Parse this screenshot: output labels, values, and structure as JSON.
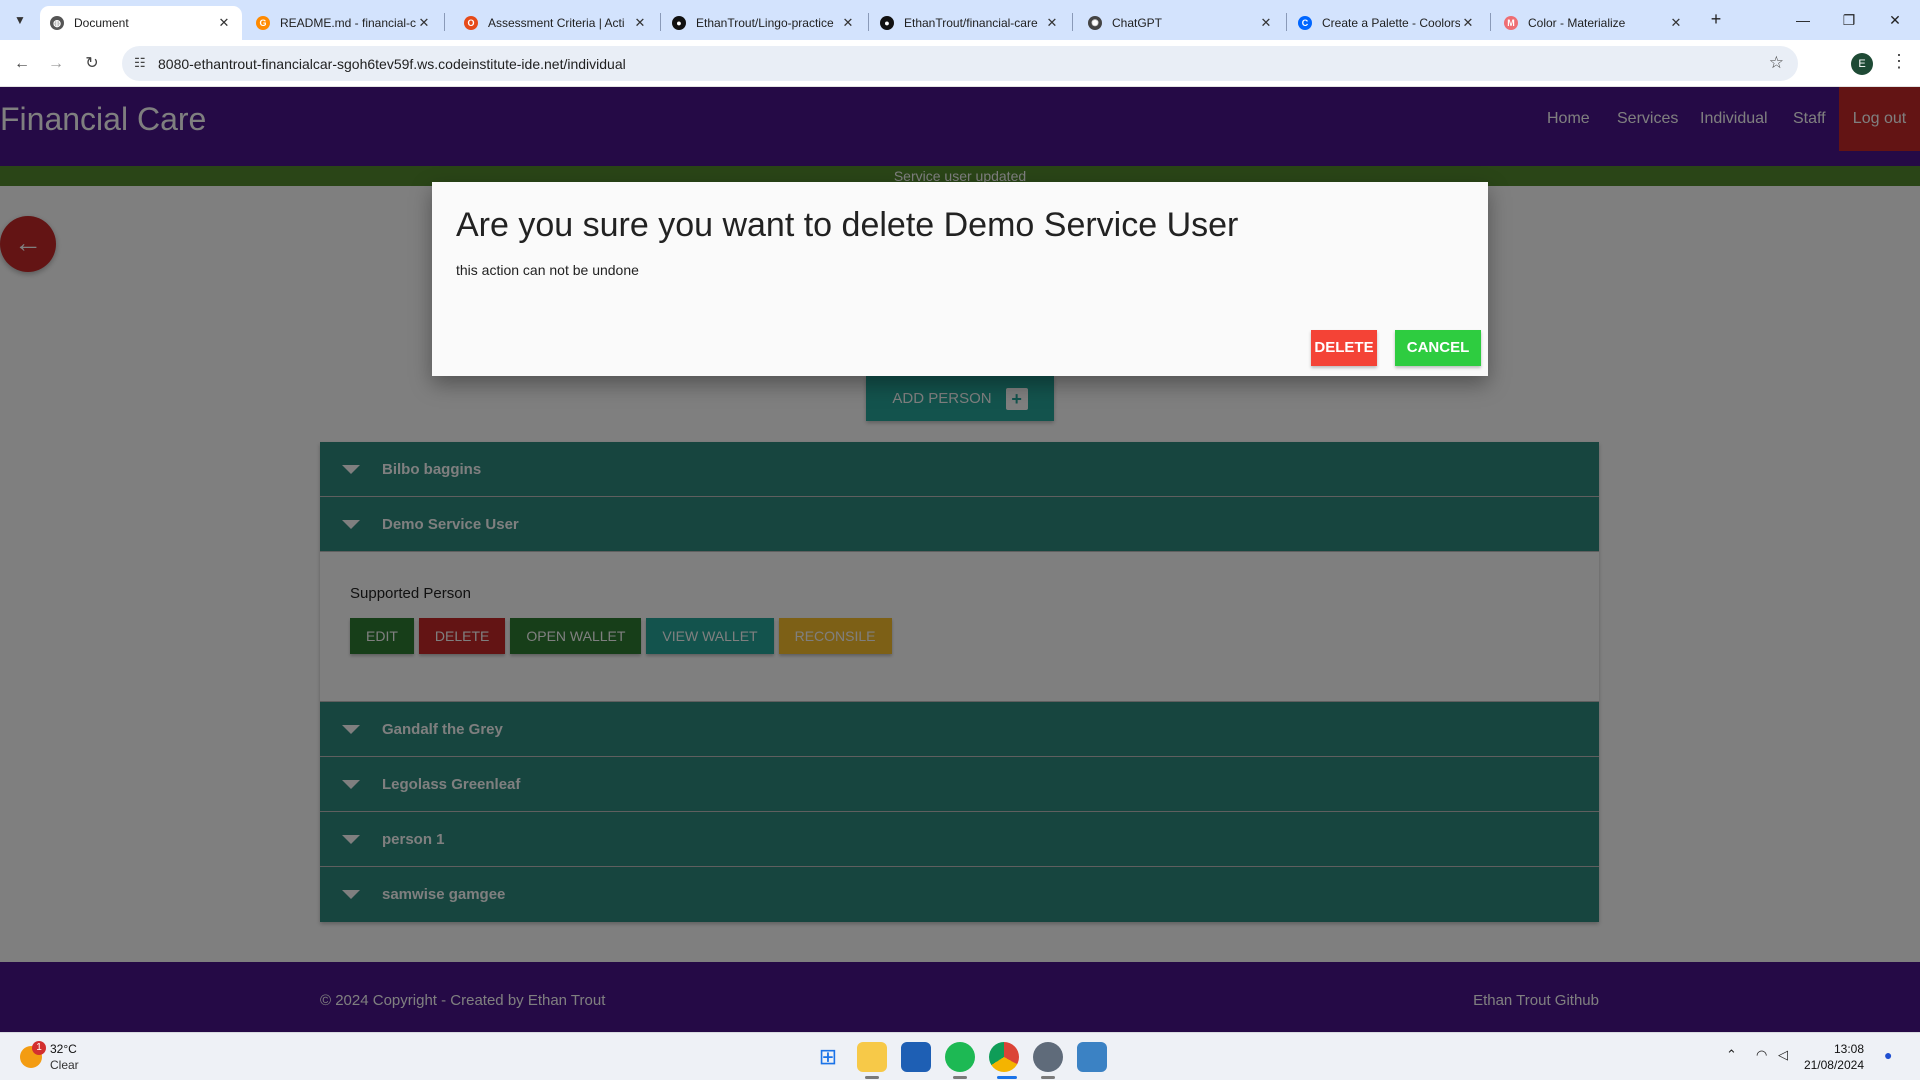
{
  "browser": {
    "tabs": [
      {
        "title": "Document",
        "favicon": "globe-icon",
        "active": true
      },
      {
        "title": "README.md - financial-ca",
        "favicon": "gitpod-icon",
        "active": false
      },
      {
        "title": "Assessment Criteria | Acti",
        "favicon": "assessment-icon",
        "active": false
      },
      {
        "title": "EthanTrout/Lingo-practice",
        "favicon": "github-icon",
        "active": false
      },
      {
        "title": "EthanTrout/financial-care",
        "favicon": "github-icon",
        "active": false
      },
      {
        "title": "ChatGPT",
        "favicon": "chatgpt-icon",
        "active": false
      },
      {
        "title": "Create a Palette - Coolors",
        "favicon": "coolors-icon",
        "active": false
      },
      {
        "title": "Color - Materialize",
        "favicon": "materialize-icon",
        "active": false
      }
    ],
    "url": "8080-ethantrout-financialcar-sgoh6tev59f.ws.codeinstitute-ide.net/individual",
    "profile_initial": "E"
  },
  "site": {
    "brand": "Financial Care",
    "nav": [
      {
        "label": "Home"
      },
      {
        "label": "Services"
      },
      {
        "label": "Individual"
      },
      {
        "label": "Staff"
      },
      {
        "label": "Log out"
      }
    ],
    "flash_message": "Service user updated"
  },
  "main": {
    "add_person_label": "ADD PERSON",
    "people": [
      {
        "name": "Bilbo baggins"
      },
      {
        "name": "Demo Service User"
      },
      {
        "name": "Gandalf the Grey"
      },
      {
        "name": "Legolass Greenleaf"
      },
      {
        "name": "person 1"
      },
      {
        "name": "samwise gamgee"
      }
    ],
    "expanded": {
      "label": "Supported Person",
      "buttons": [
        {
          "label": "EDIT",
          "color": "#2e7d32"
        },
        {
          "label": "DELETE",
          "color": "#c62828"
        },
        {
          "label": "OPEN WALLET",
          "color": "#2e7d32"
        },
        {
          "label": "VIEW WALLET",
          "color": "#26a69a"
        },
        {
          "label": "RECONSILE",
          "color": "#fbc02d"
        }
      ]
    }
  },
  "modal": {
    "title": "Are you sure you want to delete Demo Service User",
    "message": "this action can not be undone",
    "delete_label": "DELETE",
    "cancel_label": "CANCEL",
    "delete_color": "#f44336",
    "cancel_color": "#2ecc40"
  },
  "footer": {
    "copyright": "© 2024 Copyright - Created by Ethan Trout",
    "github_link": "Ethan Trout Github"
  },
  "taskbar": {
    "weather_temp": "32°C",
    "weather_condition": "Clear",
    "weather_badge": "1",
    "apps": [
      "windows-start-icon",
      "file-explorer-icon",
      "store-icon",
      "spotify-icon",
      "chrome-icon",
      "settings-icon",
      "notepad-icon"
    ],
    "time": "13:08",
    "date": "21/08/2024"
  },
  "colors": {
    "nav_purple": "#4a148c",
    "teal": "#2e8b7f",
    "flash_green": "#558b2f",
    "logout_red": "#c62828"
  }
}
